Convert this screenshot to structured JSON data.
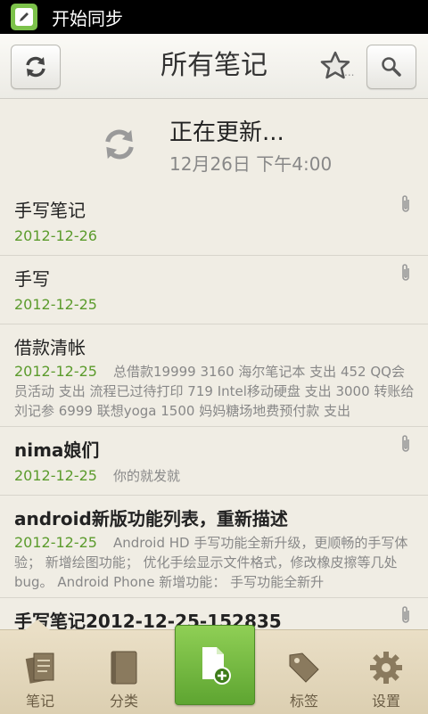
{
  "status_bar": {
    "title": "开始同步",
    "icon": "evernote-pencil-icon"
  },
  "toolbar": {
    "title": "所有笔记",
    "refresh_icon": "refresh-icon",
    "star_icon": "star-icon",
    "star_suffix": "...",
    "search_icon": "search-icon"
  },
  "sync": {
    "title": "正在更新...",
    "time": "12月26日 下午4:00"
  },
  "notes": [
    {
      "title": "手写笔记",
      "date": "2012-12-26",
      "snippet": "",
      "attachment": true
    },
    {
      "title": "手写",
      "date": "2012-12-25",
      "snippet": "",
      "attachment": true
    },
    {
      "title": "借款清帐",
      "date": "2012-12-25",
      "snippet": "总借款19999 3160 海尔笔记本 支出 452 QQ会员活动 支出 流程已过待打印 719 Intel移动硬盘 支出 3000 转账给刘记参 6999 联想yoga 1500 妈妈糖场地费预付款  支出",
      "attachment": false
    },
    {
      "title": "nima娘们",
      "date": "2012-12-25",
      "snippet": "你的就发就",
      "attachment": true
    },
    {
      "title": "android新版功能列表，重新描述",
      "date": "2012-12-25",
      "snippet": "Android HD 手写功能全新升级，更顺畅的手写体验； 新增绘图功能； 优化手绘显示文件格式，修改橡皮擦等几处bug。 Android Phone 新增功能： 手写功能全新升",
      "attachment": false
    },
    {
      "title": "手写笔记2012-12-25-152835",
      "date": "",
      "snippet": "",
      "attachment": true
    }
  ],
  "bottom_nav": {
    "items": [
      {
        "label": "笔记",
        "icon": "notes-icon"
      },
      {
        "label": "分类",
        "icon": "notebook-icon"
      },
      {
        "label": "",
        "icon": "new-note-icon"
      },
      {
        "label": "标签",
        "icon": "tag-icon"
      },
      {
        "label": "设置",
        "icon": "gear-icon"
      }
    ]
  },
  "colors": {
    "accent_green": "#6cb23b",
    "date_green": "#5b9b2c"
  }
}
